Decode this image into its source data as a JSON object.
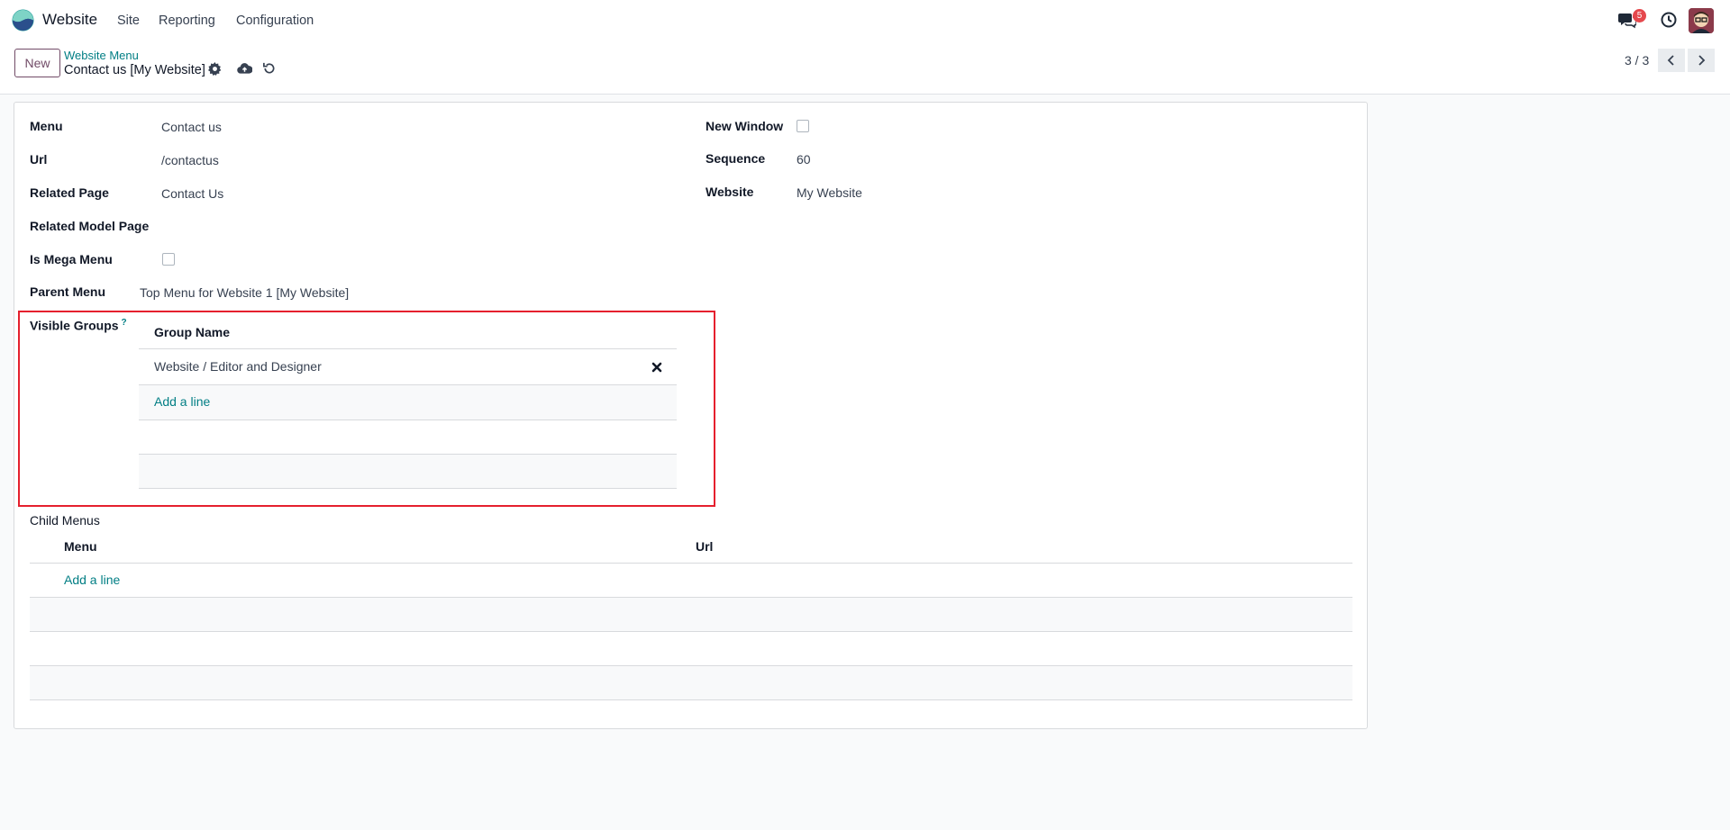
{
  "navbar": {
    "app_name": "Website",
    "menus": [
      "Site",
      "Reporting",
      "Configuration"
    ],
    "chat_badge_count": "5",
    "icons": [
      "app-logo-icon",
      "chat-icon",
      "clock-icon",
      "avatar"
    ]
  },
  "control_panel": {
    "new_label": "New",
    "breadcrumb_parent": "Website Menu",
    "breadcrumb_current": "Contact us [My Website]",
    "icons": [
      "gear-icon",
      "cloud-upload-icon",
      "discard-icon"
    ],
    "pager": "3 / 3"
  },
  "form": {
    "menu_label": "Menu",
    "menu_value": "Contact us",
    "url_label": "Url",
    "url_value": "/contactus",
    "related_page_label": "Related Page",
    "related_page_value": "Contact Us",
    "related_model_page_label": "Related Model Page",
    "is_mega_menu_label": "Is Mega Menu",
    "parent_menu_label": "Parent Menu",
    "parent_menu_value": "Top Menu for Website 1 [My Website]",
    "new_window_label": "New Window",
    "sequence_label": "Sequence",
    "sequence_value": "60",
    "website_label": "Website",
    "website_value": "My Website",
    "visible_groups_label": "Visible Groups",
    "visible_groups_help": "?",
    "groups_table": {
      "header": "Group Name",
      "rows": [
        "Website / Editor and Designer"
      ],
      "add_line": "Add a line"
    },
    "child_menus_label": "Child Menus",
    "child_table": {
      "headers": [
        "Menu",
        "Url"
      ],
      "add_line": "Add a line"
    }
  },
  "colors": {
    "accent": "#017e84",
    "brand": "#714b67",
    "highlight": "#e5202e",
    "badge": "#e5484d"
  }
}
